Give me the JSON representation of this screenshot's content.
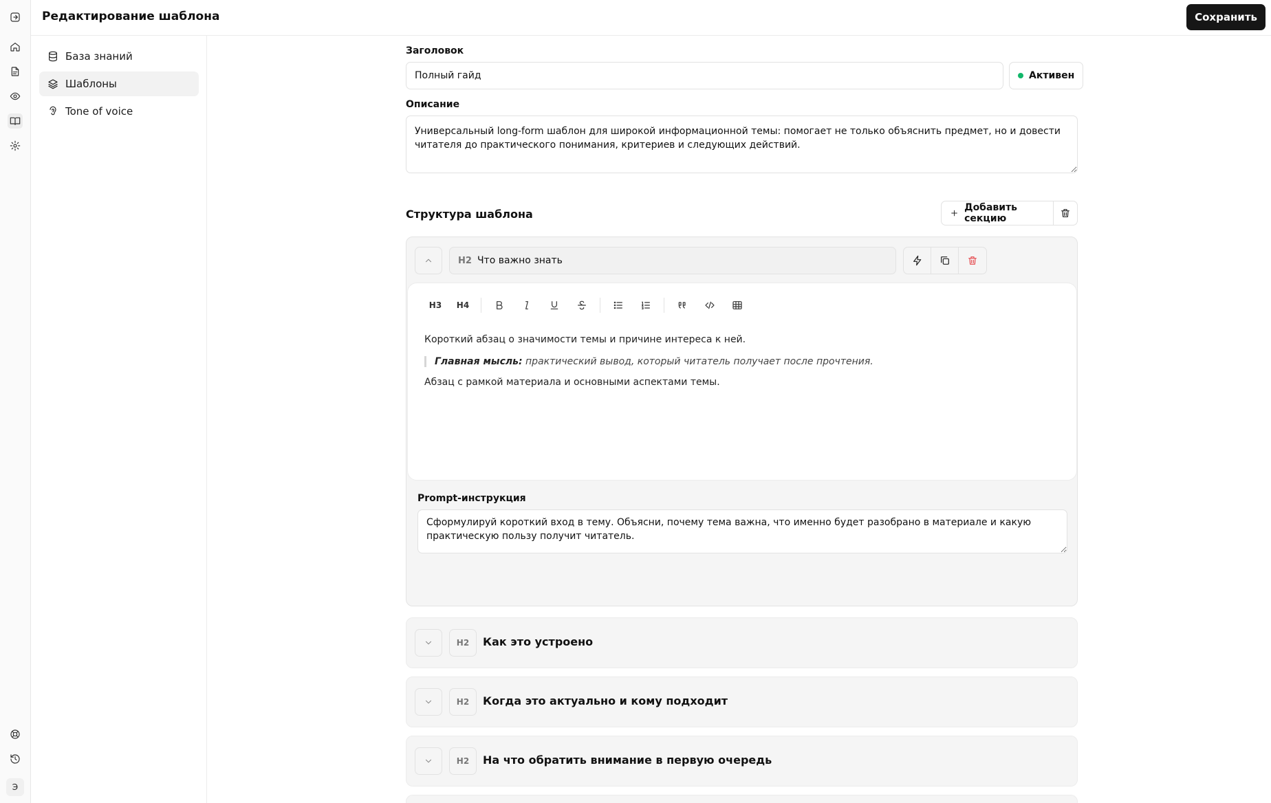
{
  "app": {
    "title": "Редактирование шаблона",
    "save_label": "Сохранить",
    "rail_bottom_label": "Э"
  },
  "rail": {
    "items": [
      "exit-icon",
      "home-icon",
      "document-icon",
      "eye-icon",
      "book-icon",
      "settings-icon"
    ],
    "bottom_items": [
      "support-icon",
      "history-icon"
    ]
  },
  "sidebar": {
    "items": [
      {
        "label": "База знаний",
        "icon": "database-icon"
      },
      {
        "label": "Шаблоны",
        "icon": "layers-icon"
      },
      {
        "label": "Tone of voice",
        "icon": "voice-icon"
      }
    ]
  },
  "form": {
    "title_label": "Заголовок",
    "title_value": "Полный гайд",
    "status_label": "Активен",
    "status_color": "#12b76a",
    "description_label": "Описание",
    "description_value": "Универсальный long-form шаблон для широкой информационной темы: помогает не только объяснить предмет, но и довести читателя до практического понимания, критериев и следующих действий."
  },
  "structure": {
    "title": "Структура шаблона",
    "add_section_label": "Добавить секцию",
    "expanded_section": {
      "level": "H2",
      "heading": "Что важно знать",
      "toolbar": {
        "h3": "H3",
        "h4": "H4"
      },
      "content": {
        "p1": "Короткий абзац о значимости темы и причине интереса к ней.",
        "quote_bold": "Главная мысль:",
        "quote_text": " практический вывод, который читатель получает после прочтения.",
        "p2": "Абзац с рамкой материала и основными аспектами темы."
      },
      "prompt_label": "Prompt-инструкция",
      "prompt_value": "Сформулируй короткий вход в тему. Объясни, почему тема важна, что именно будет разобрано в материале и какую практическую пользу получит читатель."
    },
    "collapsed_sections": [
      {
        "level": "H2",
        "title": "Как это устроено"
      },
      {
        "level": "H2",
        "title": "Когда это актуально и кому подходит"
      },
      {
        "level": "H2",
        "title": "На что обратить внимание в первую очередь"
      }
    ]
  }
}
